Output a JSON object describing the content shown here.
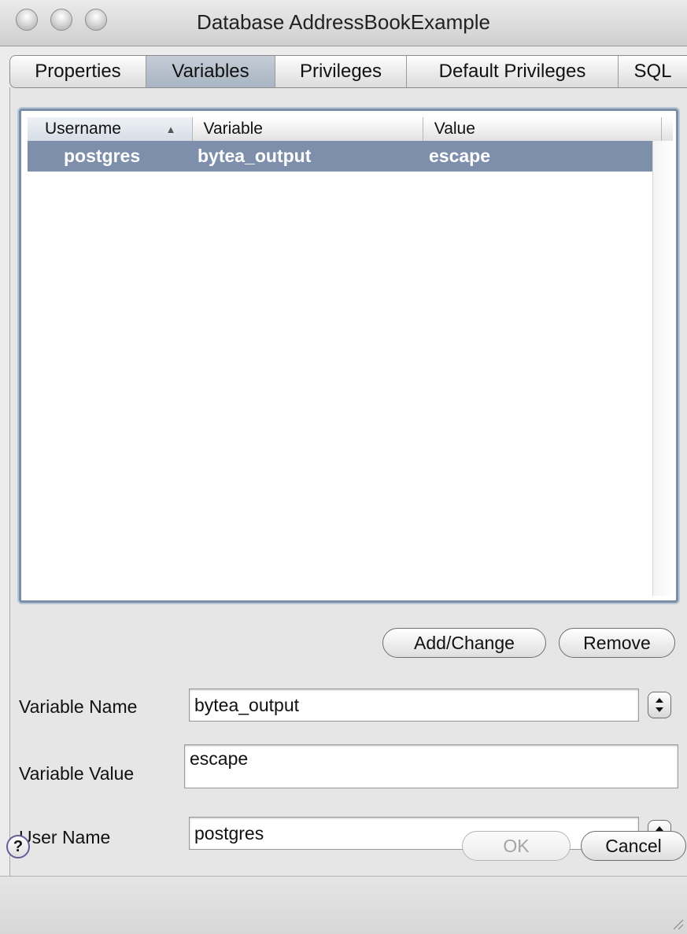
{
  "window": {
    "title": "Database AddressBookExample"
  },
  "tabs": [
    {
      "label": "Properties",
      "active": false
    },
    {
      "label": "Variables",
      "active": true
    },
    {
      "label": "Privileges",
      "active": false
    },
    {
      "label": "Default Privileges",
      "active": false
    },
    {
      "label": "SQL",
      "active": false
    }
  ],
  "table": {
    "columns": [
      "Username",
      "Variable",
      "Value"
    ],
    "sort_icon": "sort-ascending-icon",
    "rows": [
      {
        "username": "postgres",
        "variable": "bytea_output",
        "value": "escape",
        "selected": true
      }
    ]
  },
  "buttons": {
    "add_change": "Add/Change",
    "remove": "Remove",
    "ok": "OK",
    "cancel": "Cancel",
    "help": "?"
  },
  "form": {
    "variable_name_label": "Variable Name",
    "variable_name_value": "bytea_output",
    "variable_value_label": "Variable Value",
    "variable_value_value": "escape",
    "user_name_label": "User Name",
    "user_name_value": "postgres"
  },
  "colors": {
    "selection": "#7d8fab",
    "active_tab": "#b7c1ce",
    "help_ring": "#6a5a9a"
  }
}
